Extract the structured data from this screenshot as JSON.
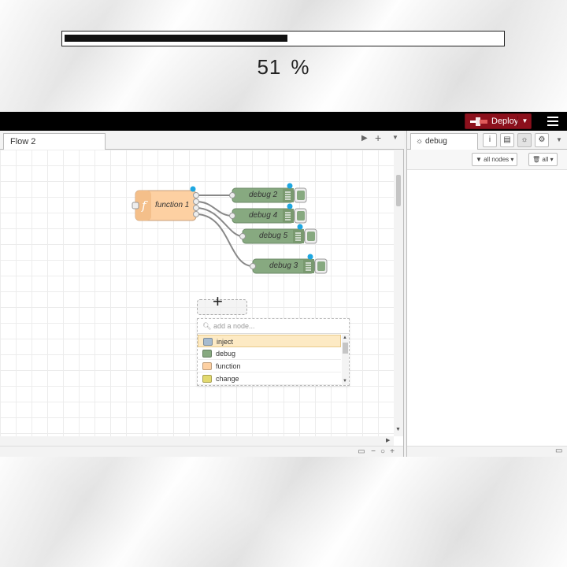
{
  "progress": {
    "value": 51,
    "percent_sign": "%",
    "fraction": 0.51
  },
  "header": {
    "deploy_label": "Deploy",
    "accent": "#8c101c"
  },
  "workspace": {
    "tabs": [
      {
        "label": "Flow 2"
      }
    ],
    "nodes": {
      "function": {
        "label": "function 1",
        "color": "#fdd0a2"
      },
      "debug": [
        {
          "label": "debug 2"
        },
        {
          "label": "debug 4"
        },
        {
          "label": "debug 5"
        },
        {
          "label": "debug 3"
        }
      ],
      "debug_color": "#87a980"
    },
    "search": {
      "placeholder": "add a node...",
      "items": [
        {
          "label": "inject",
          "color": "#a6bbcf",
          "selected": true
        },
        {
          "label": "debug",
          "color": "#87a980",
          "selected": false
        },
        {
          "label": "function",
          "color": "#fdd0a2",
          "selected": false
        },
        {
          "label": "change",
          "color": "#e2d96e",
          "selected": false
        }
      ]
    }
  },
  "sidebar": {
    "tab_label": "debug",
    "filter_label": "all nodes",
    "clear_label": "all"
  }
}
